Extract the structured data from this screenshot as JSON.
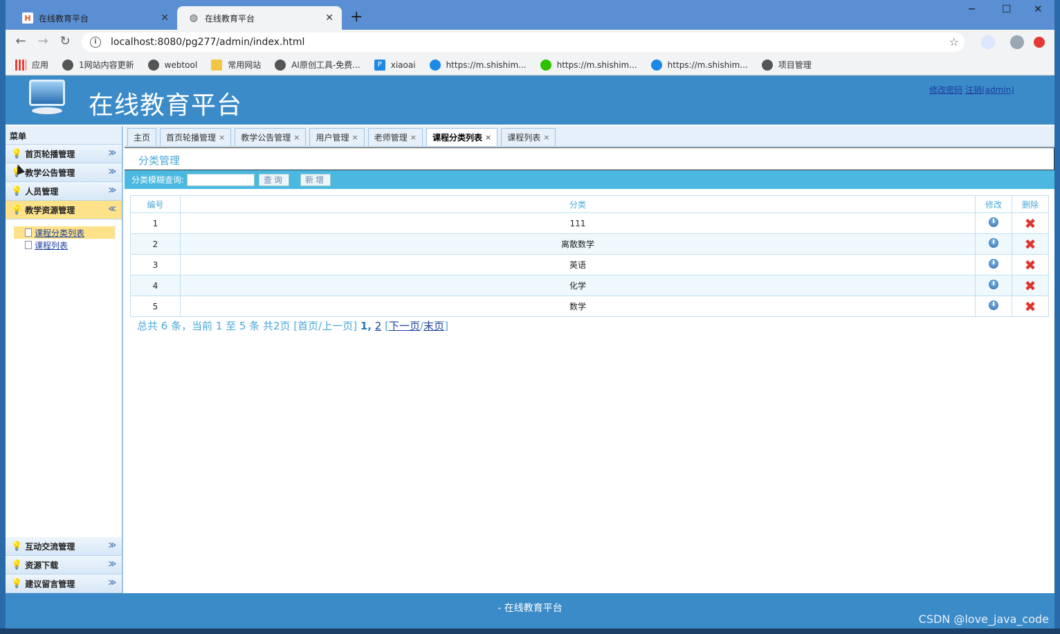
{
  "browser": {
    "tabs": [
      {
        "title": "在线教育平台",
        "icon": "h-favicon",
        "close": "✕"
      },
      {
        "title": "在线教育平台",
        "icon": "globe-icon",
        "close": "✕"
      }
    ],
    "new_tab": "+",
    "window_controls": {
      "minimize": "─",
      "maximize": "☐",
      "close": "✕"
    },
    "url": "localhost:8080/pg277/admin/index.html",
    "bookmarks": [
      {
        "label": "应用",
        "icon": "apps-grid-icon",
        "color": "#e94235"
      },
      {
        "label": "1网站内容更新",
        "icon": "globe-icon",
        "color": "#555555"
      },
      {
        "label": "webtool",
        "icon": "globe-icon",
        "color": "#555555"
      },
      {
        "label": "常用网站",
        "icon": "folder-icon",
        "color": "#f4c542"
      },
      {
        "label": "AI原创工具-免费...",
        "icon": "globe-icon",
        "color": "#555555"
      },
      {
        "label": "xiaoai",
        "icon": "p-icon",
        "color": "#1e88e5"
      },
      {
        "label": "https://m.shishim...",
        "icon": "c-icon",
        "color": "#1e88e5"
      },
      {
        "label": "https://m.shishim...",
        "icon": "wechat-icon",
        "color": "#2dc100"
      },
      {
        "label": "https://m.shishim...",
        "icon": "c-icon",
        "color": "#1e88e5"
      },
      {
        "label": "项目管理",
        "icon": "globe-icon",
        "color": "#555555"
      }
    ]
  },
  "header": {
    "title": "在线教育平台",
    "change_password": "修改密码",
    "logout": "注销(admin)"
  },
  "sidebar": {
    "heading": "菜单",
    "items": [
      {
        "label": "首页轮播管理",
        "chevron": "≫"
      },
      {
        "label": "教学公告管理",
        "chevron": "≫"
      },
      {
        "label": "人员管理",
        "chevron": "≫"
      },
      {
        "label": "教学资源管理",
        "chevron": "≪"
      }
    ],
    "subitems": [
      {
        "label": "课程分类列表"
      },
      {
        "label": "课程列表"
      }
    ],
    "bottom_items": [
      {
        "label": "互动交流管理",
        "chevron": "≫"
      },
      {
        "label": "资源下载",
        "chevron": "≫"
      },
      {
        "label": "建议留言管理",
        "chevron": "≫"
      }
    ]
  },
  "page_tabs": [
    {
      "label": "主页",
      "closable": false
    },
    {
      "label": "首页轮播管理",
      "closable": true
    },
    {
      "label": "教学公告管理",
      "closable": true
    },
    {
      "label": "用户管理",
      "closable": true
    },
    {
      "label": "老师管理",
      "closable": true
    },
    {
      "label": "课程分类列表",
      "closable": true
    },
    {
      "label": "课程列表",
      "closable": true
    }
  ],
  "panel": {
    "title": "分类管理",
    "search_label": "分类模糊查询:",
    "search_value": "",
    "query_button": "查询",
    "add_button": "新增"
  },
  "table": {
    "headers": {
      "id": "编号",
      "category": "分类",
      "edit": "修改",
      "delete": "删除"
    },
    "rows": [
      {
        "id": "1",
        "category": "111"
      },
      {
        "id": "2",
        "category": "离散数学"
      },
      {
        "id": "3",
        "category": "英语"
      },
      {
        "id": "4",
        "category": "化学"
      },
      {
        "id": "5",
        "category": "数学"
      }
    ]
  },
  "pager": {
    "summary": "总共 6 条，当前 1 至 5 条 共2页  [首页/上一页]",
    "page1": "1",
    "sep": ",",
    "page2": "2",
    "open": "[",
    "next": "下一页",
    "slash": "/",
    "last": "末页",
    "close": "]"
  },
  "footer": "- 在线教育平台",
  "watermark": "CSDN @love_java_code"
}
